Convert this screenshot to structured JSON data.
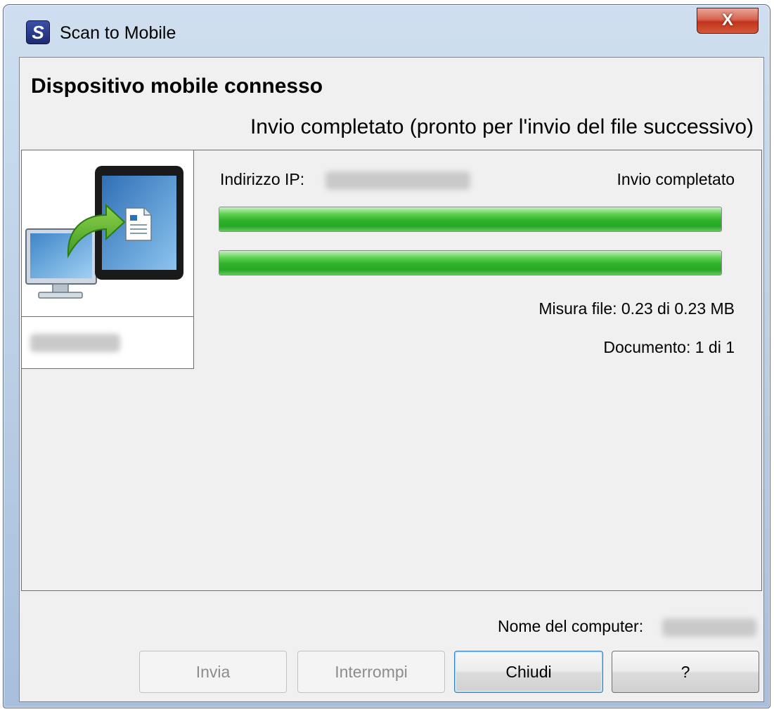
{
  "window": {
    "title": "Scan to Mobile",
    "app_icon_glyph": "S",
    "close_glyph": "X"
  },
  "header": {
    "main_title": "Dispositivo mobile connesso",
    "status": "Invio completato (pronto per l'invio del file successivo)"
  },
  "transfer": {
    "ip_label": "Indirizzo IP:",
    "status": "Invio completato",
    "progress_bars": [
      {
        "fraction": 1.0
      },
      {
        "fraction": 1.0
      }
    ],
    "file_size": "Misura file: 0.23 di 0.23 MB",
    "document_count": "Documento: 1 di 1"
  },
  "footer": {
    "computer_name_label": "Nome del computer:"
  },
  "buttons": {
    "send": "Invia",
    "stop": "Interrompi",
    "close": "Chiudi",
    "help": "?"
  },
  "colors": {
    "progress_green": "#2fb12b",
    "close_red": "#c0341d",
    "title_bar_blue": "#b9cde4",
    "dialog_gray": "#f0f0f0"
  },
  "icons": {
    "app": "scansnap-s-icon",
    "device": "computer-to-tablet-transfer-icon"
  }
}
